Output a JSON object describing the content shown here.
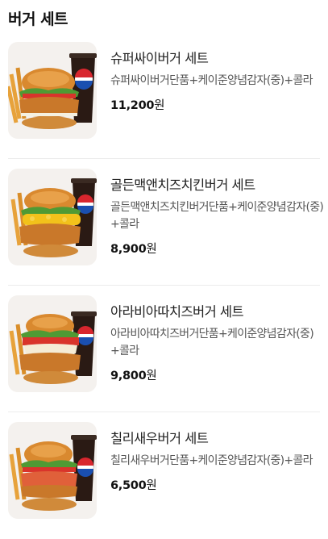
{
  "section": {
    "title": "버거 세트"
  },
  "currency": "원",
  "items": [
    {
      "name": "슈퍼싸이버거 세트",
      "desc": "슈퍼싸이버거단품+케이준양념감자(중)+콜라",
      "price": "11,200"
    },
    {
      "name": "골든맥앤치즈치킨버거 세트",
      "desc": "골든맥앤치즈치킨버거단품+케이준양념감자(중)+콜라",
      "price": "8,900"
    },
    {
      "name": "아라비아따치즈버거 세트",
      "desc": "아라비아따치즈버거단품+케이준양념감자(중)+콜라",
      "price": "9,800"
    },
    {
      "name": "칠리새우버거 세트",
      "desc": "칠리새우버거단품+케이준양념감자(중)+콜라",
      "price": "6,500"
    }
  ],
  "colors": {
    "pepsi_blue": "#1a4fb0",
    "pepsi_red": "#d8262e",
    "fries": "#e7a23b",
    "bun": "#d9892f",
    "lettuce": "#4f9a34",
    "patty": "#c9782a",
    "cheese": "#f2c21b",
    "tomato": "#d9342b"
  },
  "icons": [
    "burger-set-image",
    "pepsi-cup-icon",
    "fries-icon"
  ]
}
